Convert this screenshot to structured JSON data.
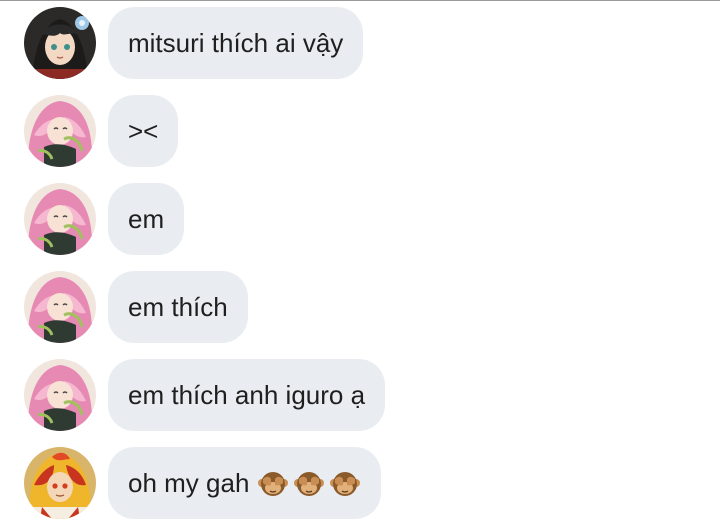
{
  "messages": [
    {
      "sender": "avatar-dark-hair",
      "text": "mitsuri thích ai vậy"
    },
    {
      "sender": "avatar-pink-hair",
      "text": "><"
    },
    {
      "sender": "avatar-pink-hair",
      "text": "em"
    },
    {
      "sender": "avatar-pink-hair",
      "text": "em thích"
    },
    {
      "sender": "avatar-pink-hair",
      "text": "em thích anh iguro ạ"
    },
    {
      "sender": "avatar-flame-hair",
      "text": "oh my gah",
      "emoji": [
        "see-no-evil-monkey",
        "see-no-evil-monkey",
        "see-no-evil-monkey"
      ]
    }
  ],
  "colors": {
    "bubble": "#e9edf1",
    "text": "#1f1f1f"
  }
}
